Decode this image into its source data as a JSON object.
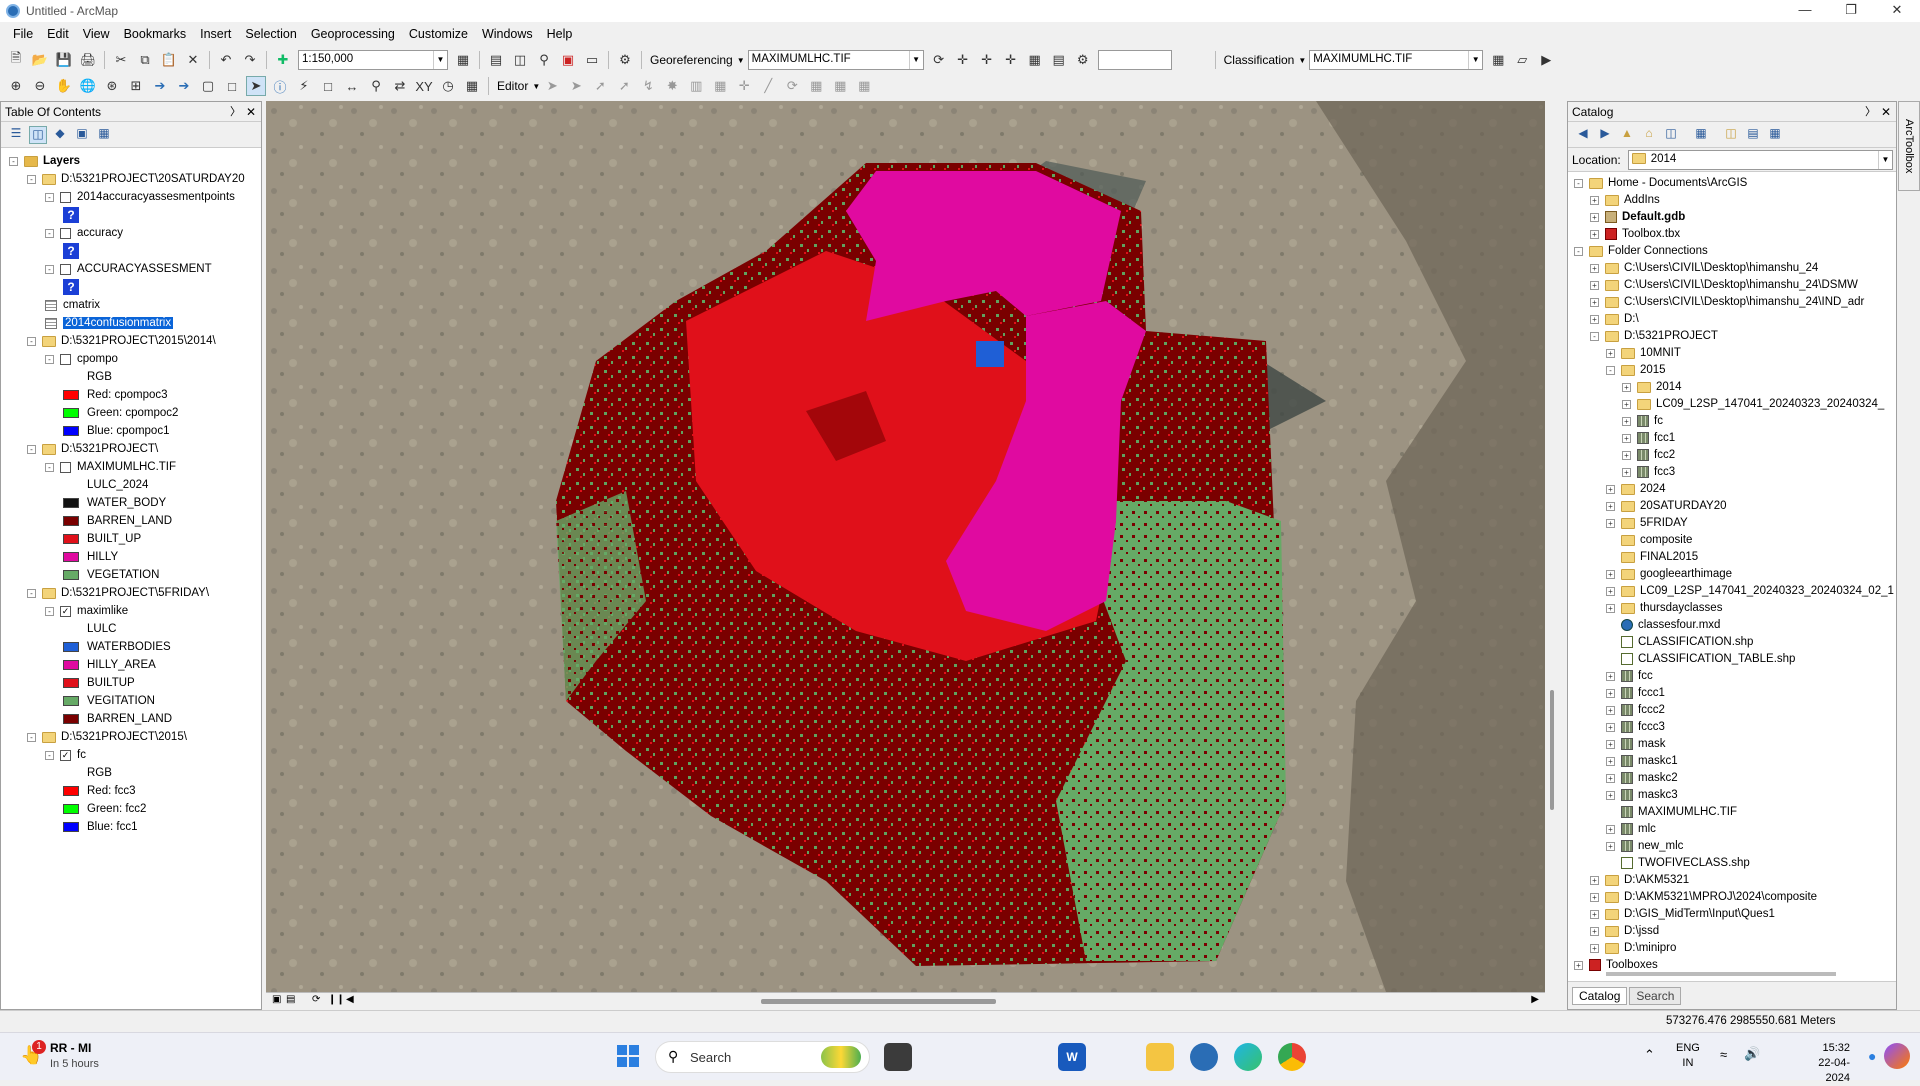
{
  "window": {
    "title": "Untitled - ArcMap"
  },
  "menu": [
    "File",
    "Edit",
    "View",
    "Bookmarks",
    "Insert",
    "Selection",
    "Geoprocessing",
    "Customize",
    "Windows",
    "Help"
  ],
  "toolbar": {
    "scale": "1:150,000",
    "georef_label": "Georeferencing",
    "georef_layer": "MAXIMUMLHC.TIF",
    "class_label": "Classification",
    "class_layer": "MAXIMUMLHC.TIF",
    "editor_label": "Editor"
  },
  "toc": {
    "title": "Table Of Contents",
    "rows": [
      {
        "label": "Layers",
        "indent": 0,
        "exp": "-",
        "type": "layers",
        "bold": true
      },
      {
        "label": "D:\\5321PROJECT\\20SATURDAY20",
        "indent": 1,
        "exp": "-",
        "type": "folder"
      },
      {
        "label": "2014accuracyassesmentpoints",
        "indent": 2,
        "exp": "-",
        "type": "check",
        "checked": false
      },
      {
        "label": "",
        "indent": 3,
        "type": "qmark"
      },
      {
        "label": "accuracy",
        "indent": 2,
        "exp": "-",
        "type": "check",
        "checked": false
      },
      {
        "label": "",
        "indent": 3,
        "type": "qmark"
      },
      {
        "label": "ACCURACYASSESMENT",
        "indent": 2,
        "exp": "-",
        "type": "check",
        "checked": false
      },
      {
        "label": "",
        "indent": 3,
        "type": "qmark"
      },
      {
        "label": "cmatrix",
        "indent": 2,
        "type": "table"
      },
      {
        "label": "2014confusionmatrix",
        "indent": 2,
        "type": "table",
        "selected": true
      },
      {
        "label": "D:\\5321PROJECT\\2015\\2014\\",
        "indent": 1,
        "exp": "-",
        "type": "folder"
      },
      {
        "label": "cpompo",
        "indent": 2,
        "exp": "-",
        "type": "check",
        "checked": false
      },
      {
        "label": "RGB",
        "indent": 3,
        "type": "text"
      },
      {
        "label": "Red:   cpompoc3",
        "indent": 3,
        "type": "swatch",
        "color": "#ff0000"
      },
      {
        "label": "Green: cpompoc2",
        "indent": 3,
        "type": "swatch",
        "color": "#00ff00"
      },
      {
        "label": "Blue:  cpompoc1",
        "indent": 3,
        "type": "swatch",
        "color": "#0000ff"
      },
      {
        "label": "D:\\5321PROJECT\\",
        "indent": 1,
        "exp": "-",
        "type": "folder"
      },
      {
        "label": "MAXIMUMLHC.TIF",
        "indent": 2,
        "exp": "-",
        "type": "check",
        "checked": false
      },
      {
        "label": "LULC_2024",
        "indent": 3,
        "type": "text"
      },
      {
        "label": "WATER_BODY",
        "indent": 3,
        "type": "swatch",
        "color": "#111111"
      },
      {
        "label": "BARREN_LAND",
        "indent": 3,
        "type": "swatch",
        "color": "#7a0000"
      },
      {
        "label": "BUILT_UP",
        "indent": 3,
        "type": "swatch",
        "color": "#e0101a"
      },
      {
        "label": "HILLY",
        "indent": 3,
        "type": "swatch",
        "color": "#e00aa0"
      },
      {
        "label": "VEGETATION",
        "indent": 3,
        "type": "swatch",
        "color": "#66aa66"
      },
      {
        "label": "D:\\5321PROJECT\\5FRIDAY\\",
        "indent": 1,
        "exp": "-",
        "type": "folder"
      },
      {
        "label": "maximlike",
        "indent": 2,
        "exp": "-",
        "type": "check",
        "checked": true
      },
      {
        "label": "LULC",
        "indent": 3,
        "type": "text"
      },
      {
        "label": "WATERBODIES",
        "indent": 3,
        "type": "swatch",
        "color": "#1f5fd6"
      },
      {
        "label": "HILLY_AREA",
        "indent": 3,
        "type": "swatch",
        "color": "#e00aa0"
      },
      {
        "label": "BUILTUP",
        "indent": 3,
        "type": "swatch",
        "color": "#e0101a"
      },
      {
        "label": "VEGITATION",
        "indent": 3,
        "type": "swatch",
        "color": "#66aa66"
      },
      {
        "label": "BARREN_LAND",
        "indent": 3,
        "type": "swatch",
        "color": "#7a0000"
      },
      {
        "label": "D:\\5321PROJECT\\2015\\",
        "indent": 1,
        "exp": "-",
        "type": "folder"
      },
      {
        "label": "fc",
        "indent": 2,
        "exp": "-",
        "type": "check",
        "checked": true
      },
      {
        "label": "RGB",
        "indent": 3,
        "type": "text"
      },
      {
        "label": "Red:   fcc3",
        "indent": 3,
        "type": "swatch",
        "color": "#ff0000"
      },
      {
        "label": "Green: fcc2",
        "indent": 3,
        "type": "swatch",
        "color": "#00ff00"
      },
      {
        "label": "Blue:  fcc1",
        "indent": 3,
        "type": "swatch",
        "color": "#0000ff"
      }
    ]
  },
  "catalog": {
    "title": "Catalog",
    "location_label": "Location:",
    "location_value": "2014",
    "tabs": [
      "Catalog",
      "Search"
    ],
    "rows": [
      {
        "label": "Home - Documents\\ArcGIS",
        "indent": 0,
        "exp": "-",
        "icon": "folder"
      },
      {
        "label": "AddIns",
        "indent": 1,
        "exp": "+",
        "icon": "folder"
      },
      {
        "label": "Default.gdb",
        "indent": 1,
        "exp": "+",
        "icon": "gdb",
        "bold": true
      },
      {
        "label": "Toolbox.tbx",
        "indent": 1,
        "exp": "+",
        "icon": "tbx"
      },
      {
        "label": "Folder Connections",
        "indent": 0,
        "exp": "-",
        "icon": "folder"
      },
      {
        "label": "C:\\Users\\CIVIL\\Desktop\\himanshu_24",
        "indent": 1,
        "exp": "+",
        "icon": "folder"
      },
      {
        "label": "C:\\Users\\CIVIL\\Desktop\\himanshu_24\\DSMW",
        "indent": 1,
        "exp": "+",
        "icon": "folder"
      },
      {
        "label": "C:\\Users\\CIVIL\\Desktop\\himanshu_24\\IND_adr",
        "indent": 1,
        "exp": "+",
        "icon": "folder"
      },
      {
        "label": "D:\\",
        "indent": 1,
        "exp": "+",
        "icon": "folder"
      },
      {
        "label": "D:\\5321PROJECT",
        "indent": 1,
        "exp": "-",
        "icon": "folder"
      },
      {
        "label": "10MNIT",
        "indent": 2,
        "exp": "+",
        "icon": "folder"
      },
      {
        "label": "2015",
        "indent": 2,
        "exp": "-",
        "icon": "folder"
      },
      {
        "label": "2014",
        "indent": 3,
        "exp": "+",
        "icon": "folder"
      },
      {
        "label": "LC09_L2SP_147041_20240323_20240324_",
        "indent": 3,
        "exp": "+",
        "icon": "folder"
      },
      {
        "label": "fc",
        "indent": 3,
        "exp": "+",
        "icon": "raster"
      },
      {
        "label": "fcc1",
        "indent": 3,
        "exp": "+",
        "icon": "raster"
      },
      {
        "label": "fcc2",
        "indent": 3,
        "exp": "+",
        "icon": "raster"
      },
      {
        "label": "fcc3",
        "indent": 3,
        "exp": "+",
        "icon": "raster"
      },
      {
        "label": "2024",
        "indent": 2,
        "exp": "+",
        "icon": "folder"
      },
      {
        "label": "20SATURDAY20",
        "indent": 2,
        "exp": "+",
        "icon": "folder"
      },
      {
        "label": "5FRIDAY",
        "indent": 2,
        "exp": "+",
        "icon": "folder"
      },
      {
        "label": "composite",
        "indent": 2,
        "icon": "folder"
      },
      {
        "label": "FINAL2015",
        "indent": 2,
        "icon": "folder"
      },
      {
        "label": "googleearthimage",
        "indent": 2,
        "exp": "+",
        "icon": "folder"
      },
      {
        "label": "LC09_L2SP_147041_20240323_20240324_02_1",
        "indent": 2,
        "exp": "+",
        "icon": "folder"
      },
      {
        "label": "thursdayclasses",
        "indent": 2,
        "exp": "+",
        "icon": "folder"
      },
      {
        "label": "classesfour.mxd",
        "indent": 2,
        "icon": "mxd"
      },
      {
        "label": "CLASSIFICATION.shp",
        "indent": 2,
        "icon": "shp"
      },
      {
        "label": "CLASSIFICATION_TABLE.shp",
        "indent": 2,
        "icon": "shp"
      },
      {
        "label": "fcc",
        "indent": 2,
        "exp": "+",
        "icon": "raster"
      },
      {
        "label": "fccc1",
        "indent": 2,
        "exp": "+",
        "icon": "raster"
      },
      {
        "label": "fccc2",
        "indent": 2,
        "exp": "+",
        "icon": "raster"
      },
      {
        "label": "fccc3",
        "indent": 2,
        "exp": "+",
        "icon": "raster"
      },
      {
        "label": "mask",
        "indent": 2,
        "exp": "+",
        "icon": "raster"
      },
      {
        "label": "maskc1",
        "indent": 2,
        "exp": "+",
        "icon": "raster"
      },
      {
        "label": "maskc2",
        "indent": 2,
        "exp": "+",
        "icon": "raster"
      },
      {
        "label": "maskc3",
        "indent": 2,
        "exp": "+",
        "icon": "raster"
      },
      {
        "label": "MAXIMUMLHC.TIF",
        "indent": 2,
        "icon": "raster"
      },
      {
        "label": "mlc",
        "indent": 2,
        "exp": "+",
        "icon": "raster"
      },
      {
        "label": "new_mlc",
        "indent": 2,
        "exp": "+",
        "icon": "raster"
      },
      {
        "label": "TWOFIVECLASS.shp",
        "indent": 2,
        "icon": "shp"
      },
      {
        "label": "D:\\AKM5321",
        "indent": 1,
        "exp": "+",
        "icon": "folder"
      },
      {
        "label": "D:\\AKM5321\\MPROJ\\2024\\composite",
        "indent": 1,
        "exp": "+",
        "icon": "folder"
      },
      {
        "label": "D:\\GIS_MidTerm\\Input\\Ques1",
        "indent": 1,
        "exp": "+",
        "icon": "folder"
      },
      {
        "label": "D:\\jssd",
        "indent": 1,
        "exp": "+",
        "icon": "folder"
      },
      {
        "label": "D:\\minipro",
        "indent": 1,
        "exp": "+",
        "icon": "folder"
      },
      {
        "label": "Toolboxes",
        "indent": 0,
        "exp": "+",
        "icon": "tbx"
      }
    ]
  },
  "arctoolbox": "ArcToolbox",
  "status": {
    "coords": "573276.476  2985550.681 Meters"
  },
  "taskbar": {
    "notif_title": "RR - MI",
    "notif_sub": "In 5 hours",
    "notif_badge": "1",
    "search": "Search",
    "lang1": "ENG",
    "lang2": "IN",
    "time": "15:32",
    "date": "22-04-2024"
  }
}
